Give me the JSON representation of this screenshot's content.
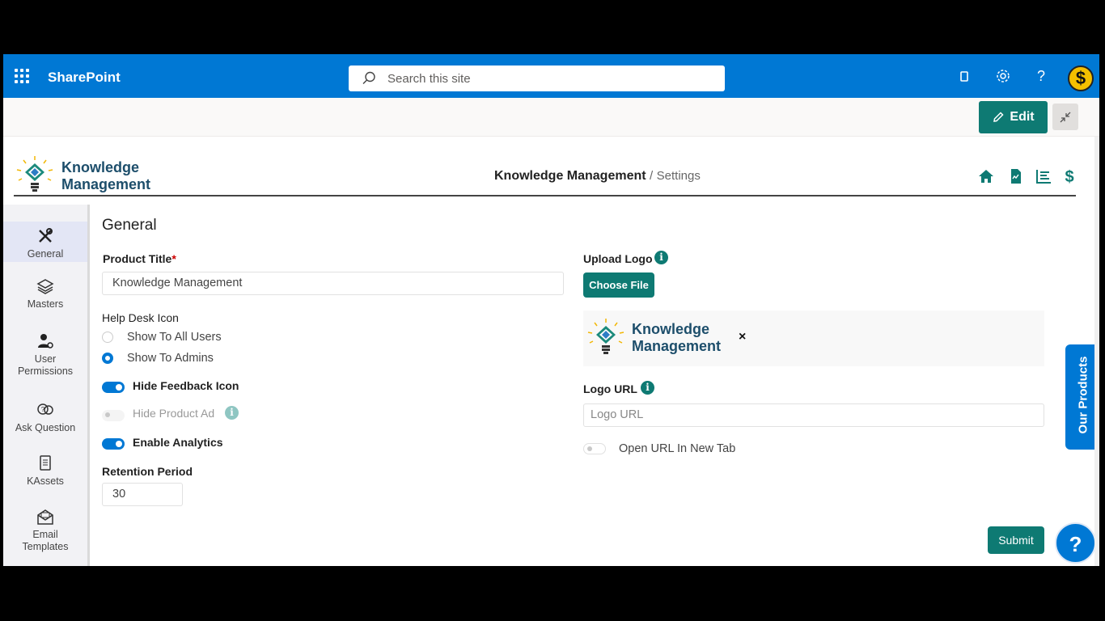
{
  "topbar": {
    "app_name": "SharePoint",
    "search_placeholder": "Search this site",
    "avatar_letter": "$"
  },
  "command": {
    "edit_label": "Edit"
  },
  "header": {
    "logo_line1": "Knowledge",
    "logo_line2": "Management",
    "breadcrumb_main": "Knowledge Management",
    "breadcrumb_sep": "/",
    "breadcrumb_sub": "Settings"
  },
  "sidebar": {
    "items": [
      {
        "label": "General"
      },
      {
        "label": "Masters"
      },
      {
        "label": "User Permissions"
      },
      {
        "label": "Ask Question"
      },
      {
        "label": "KAssets"
      },
      {
        "label": "Email Templates"
      }
    ]
  },
  "form": {
    "section_title": "General",
    "product_title_label": "Product Title",
    "product_title_value": "Knowledge Management",
    "help_desk_label": "Help Desk Icon",
    "radio_all": "Show To All Users",
    "radio_admins": "Show To Admins",
    "selected_radio": "Show To Admins",
    "hide_feedback_label": "Hide Feedback Icon",
    "hide_feedback_on": true,
    "hide_product_ad_label": "Hide Product Ad",
    "hide_product_ad_on": false,
    "enable_analytics_label": "Enable Analytics",
    "enable_analytics_on": true,
    "retention_label": "Retention Period",
    "retention_value": "30",
    "upload_logo_label": "Upload Logo",
    "choose_file_label": "Choose File",
    "preview_line1": "Knowledge",
    "preview_line2": "Management",
    "remove_label": "×",
    "logo_url_label": "Logo URL",
    "logo_url_placeholder": "Logo URL",
    "open_new_tab_label": "Open URL In New Tab",
    "open_new_tab_on": false,
    "info_glyph": "i",
    "submit_label": "Submit"
  },
  "floating": {
    "our_products": "Our Products",
    "help_glyph": "?"
  },
  "colors": {
    "brand_blue": "#0078d4",
    "teal": "#0e7a73",
    "logo_text": "#1d4e6b"
  }
}
